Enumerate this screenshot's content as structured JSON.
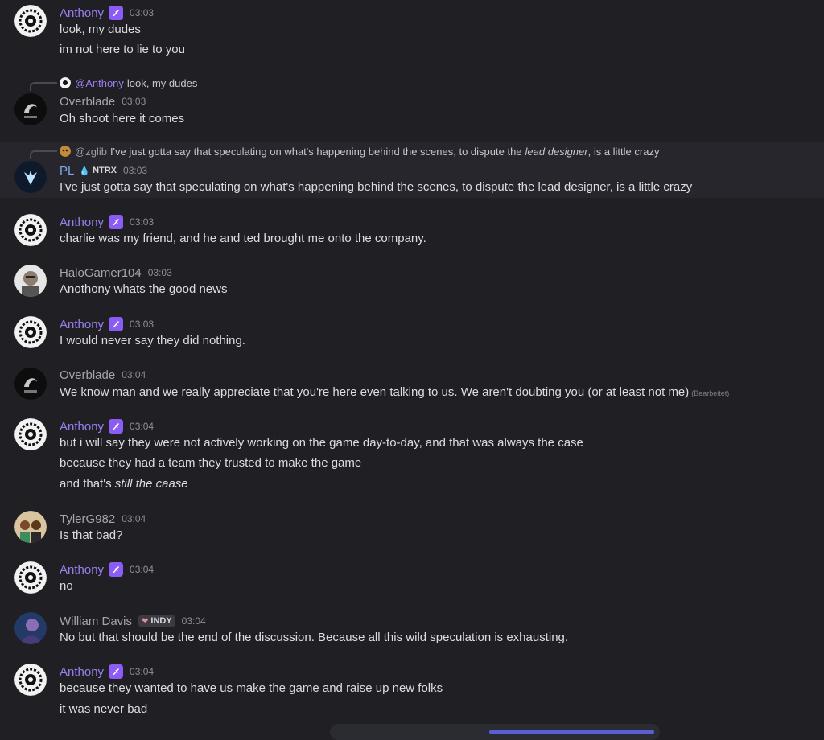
{
  "messages": [
    {
      "author": "Anthony",
      "time": "03:03",
      "lines": [
        "look, my dudes",
        "im not here to lie to you"
      ]
    },
    {
      "reply": {
        "mention": "@Anthony",
        "text": "look, my dudes"
      },
      "author": "Overblade",
      "time": "03:03",
      "lines": [
        "Oh shoot here it comes"
      ]
    },
    {
      "reply": {
        "name": "@zglib",
        "text_before": "I've just gotta say that speculating on what's happening behind the scenes, to dispute the",
        "text_em": "lead designer",
        "text_after": ", is a little crazy"
      },
      "author": "PL",
      "tag": "NTRX",
      "time": "03:03",
      "lines": [
        "I've just gotta say that speculating on what's happening behind the scenes, to dispute the lead designer, is a little crazy"
      ]
    },
    {
      "author": "Anthony",
      "time": "03:03",
      "lines": [
        "charlie was my friend, and he and ted brought me onto the company."
      ]
    },
    {
      "author": "HaloGamer104",
      "time": "03:03",
      "lines": [
        "Anothony whats the good news"
      ]
    },
    {
      "author": "Anthony",
      "time": "03:03",
      "lines": [
        "I would never say they did nothing."
      ]
    },
    {
      "author": "Overblade",
      "time": "03:04",
      "lines": [
        "We know man and we really appreciate that you're here even talking to us. We aren't doubting you (or at least not me)"
      ],
      "edited": "(Bearbeitet)"
    },
    {
      "author": "Anthony",
      "time": "03:04",
      "lines": [
        "but i will say they were not actively working on the game day-to-day, and that was always the case",
        "because they had a team they trusted to make the game"
      ],
      "last_line_plain": "and that's ",
      "last_line_em": "still the caase"
    },
    {
      "author": "TylerG982",
      "time": "03:04",
      "lines": [
        "Is that bad?"
      ]
    },
    {
      "author": "Anthony",
      "time": "03:04",
      "lines": [
        "no"
      ]
    },
    {
      "author": "William Davis",
      "tag": "INDY",
      "time": "03:04",
      "lines": [
        "No but that should be the end of the discussion. Because all this wild speculation is exhausting."
      ]
    },
    {
      "author": "Anthony",
      "time": "03:04",
      "lines": [
        "because they wanted to have us make the game and raise up new folks",
        "it was never bad"
      ]
    }
  ],
  "colors": {
    "background": "#1f1f24",
    "highlight": "#26262c",
    "anthony": "#9a7ff0",
    "badge": "#8b5cf6"
  }
}
